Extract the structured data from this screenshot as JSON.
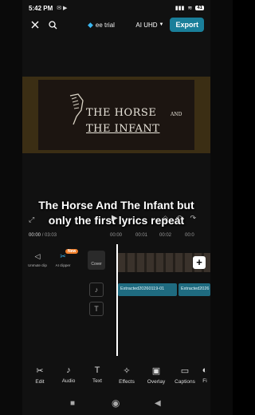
{
  "status": {
    "time": "5:42 PM",
    "icons": "✉ ▶",
    "signal": "▮▮▮",
    "battery": "41"
  },
  "topbar": {
    "trial_label": "ee trial",
    "quality": "AI UHD",
    "export_label": "Export"
  },
  "preview": {
    "line1": "THE HORSE",
    "line1_small": "AND",
    "line2": "THE INFANT"
  },
  "caption": {
    "line1": "The Horse And The Infant but",
    "line2": "only the first lyrics repeat"
  },
  "timecode": {
    "current": "00:00",
    "total": "03:03"
  },
  "ruler": [
    "00:00",
    "00:01",
    "00:02",
    "00:0"
  ],
  "tools": {
    "unmute": "Unmute clip",
    "ai_clipper": "AI clipper",
    "cover": "Cover",
    "new_badge": "New"
  },
  "audio": {
    "clip1": "Extracted20260119-01",
    "clip2": "Extracted2026"
  },
  "bottom": [
    {
      "label": "Edit",
      "icon": "scissors-icon"
    },
    {
      "label": "Audio",
      "icon": "music-note-icon"
    },
    {
      "label": "Text",
      "icon": "text-icon"
    },
    {
      "label": "Effects",
      "icon": "sparkle-icon"
    },
    {
      "label": "Overlay",
      "icon": "overlay-icon"
    },
    {
      "label": "Captions",
      "icon": "captions-icon"
    },
    {
      "label": "Fi",
      "icon": "filters-icon"
    }
  ],
  "colors": {
    "export": "#1a7f9a",
    "audio_clip": "#1f6b80",
    "new_badge": "#f07e2a",
    "gem": "#3bb8f2"
  }
}
